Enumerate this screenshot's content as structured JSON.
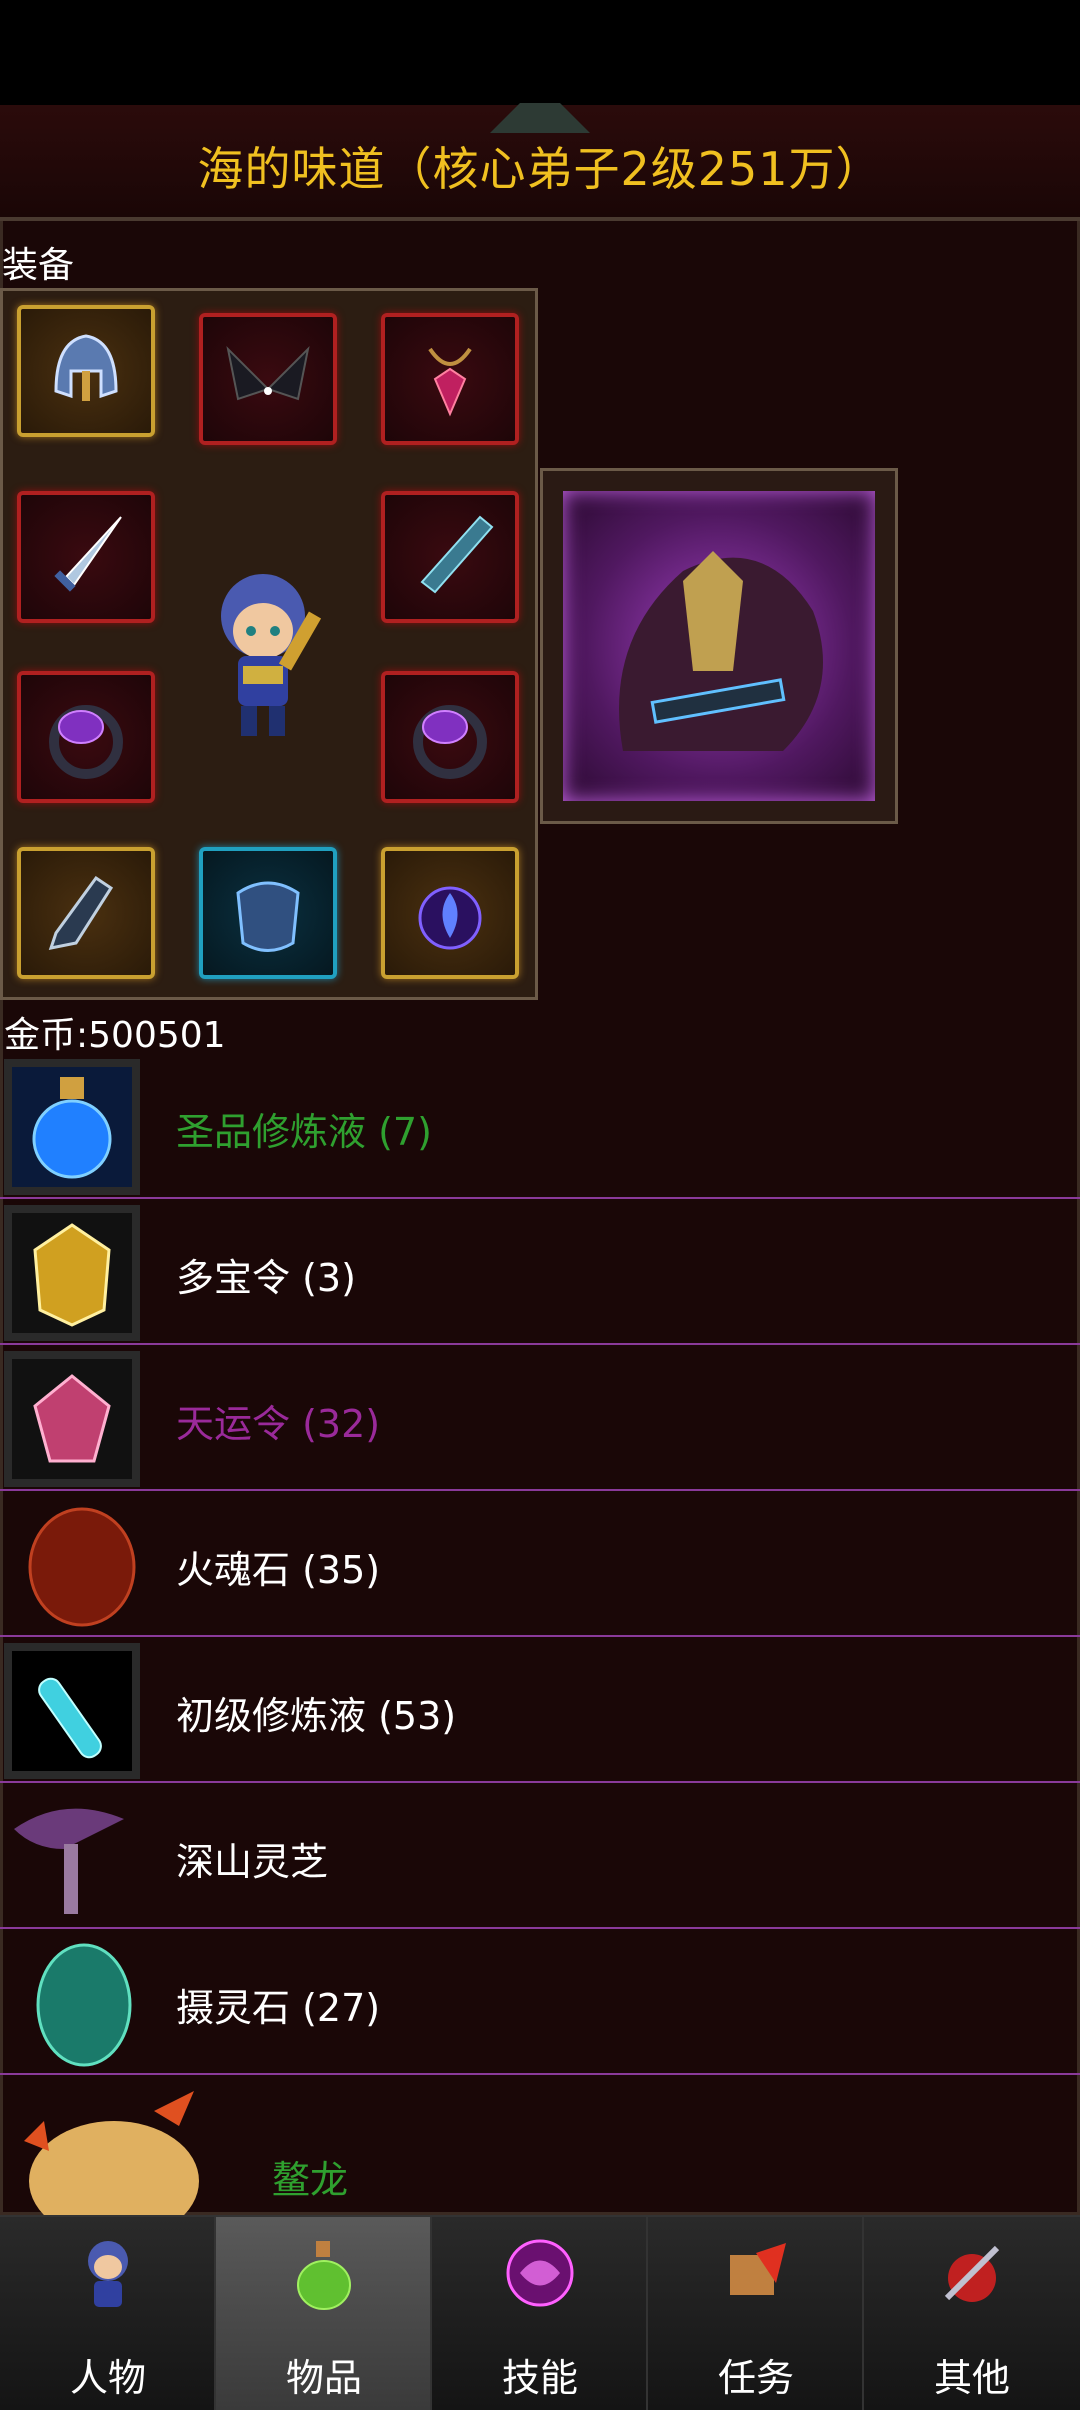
{
  "header": {
    "title": "海的味道（核心弟子2级251万）"
  },
  "equipment": {
    "label": "装备",
    "slots": [
      {
        "icon": "helmet-icon",
        "rarity": "gold"
      },
      {
        "icon": "wings-icon",
        "rarity": "red"
      },
      {
        "icon": "amulet-icon",
        "rarity": "red"
      },
      {
        "icon": "sword-icon",
        "rarity": "red"
      },
      {
        "icon": "greatsword-icon",
        "rarity": "red"
      },
      {
        "icon": "ring-icon",
        "rarity": "red"
      },
      {
        "icon": "ring-icon",
        "rarity": "red"
      },
      {
        "icon": "boots-icon",
        "rarity": "gold"
      },
      {
        "icon": "dragon-armor-icon",
        "rarity": "cyan"
      },
      {
        "icon": "flame-orb-icon",
        "rarity": "gold"
      }
    ]
  },
  "gold": {
    "text": "金币:500501"
  },
  "items": [
    {
      "name": "圣品修炼液 (7)",
      "color": "#2fa02f",
      "icon": "blue-potion-icon"
    },
    {
      "name": "多宝令 (3)",
      "color": "#ffffff",
      "icon": "gold-token-icon"
    },
    {
      "name": "天运令 (32)",
      "color": "#9a2a9a",
      "icon": "pink-token-icon"
    },
    {
      "name": "火魂石 (35)",
      "color": "#ffffff",
      "icon": "fire-stone-icon"
    },
    {
      "name": "初级修炼液 (53)",
      "color": "#ffffff",
      "icon": "vial-icon"
    },
    {
      "name": "深山灵芝",
      "color": "#ffffff",
      "icon": "mushroom-icon"
    },
    {
      "name": "摄灵石 (27)",
      "color": "#ffffff",
      "icon": "green-egg-icon"
    },
    {
      "name": "鳌龙",
      "color": "#2fa02f",
      "icon": "dragon-pet-icon"
    }
  ],
  "tabs": [
    {
      "label": "人物",
      "icon": "character-icon",
      "active": false
    },
    {
      "label": "物品",
      "icon": "bag-icon",
      "active": true
    },
    {
      "label": "技能",
      "icon": "skill-orb-icon",
      "active": false
    },
    {
      "label": "任务",
      "icon": "quest-icon",
      "active": false
    },
    {
      "label": "其他",
      "icon": "misc-icon",
      "active": false
    }
  ]
}
